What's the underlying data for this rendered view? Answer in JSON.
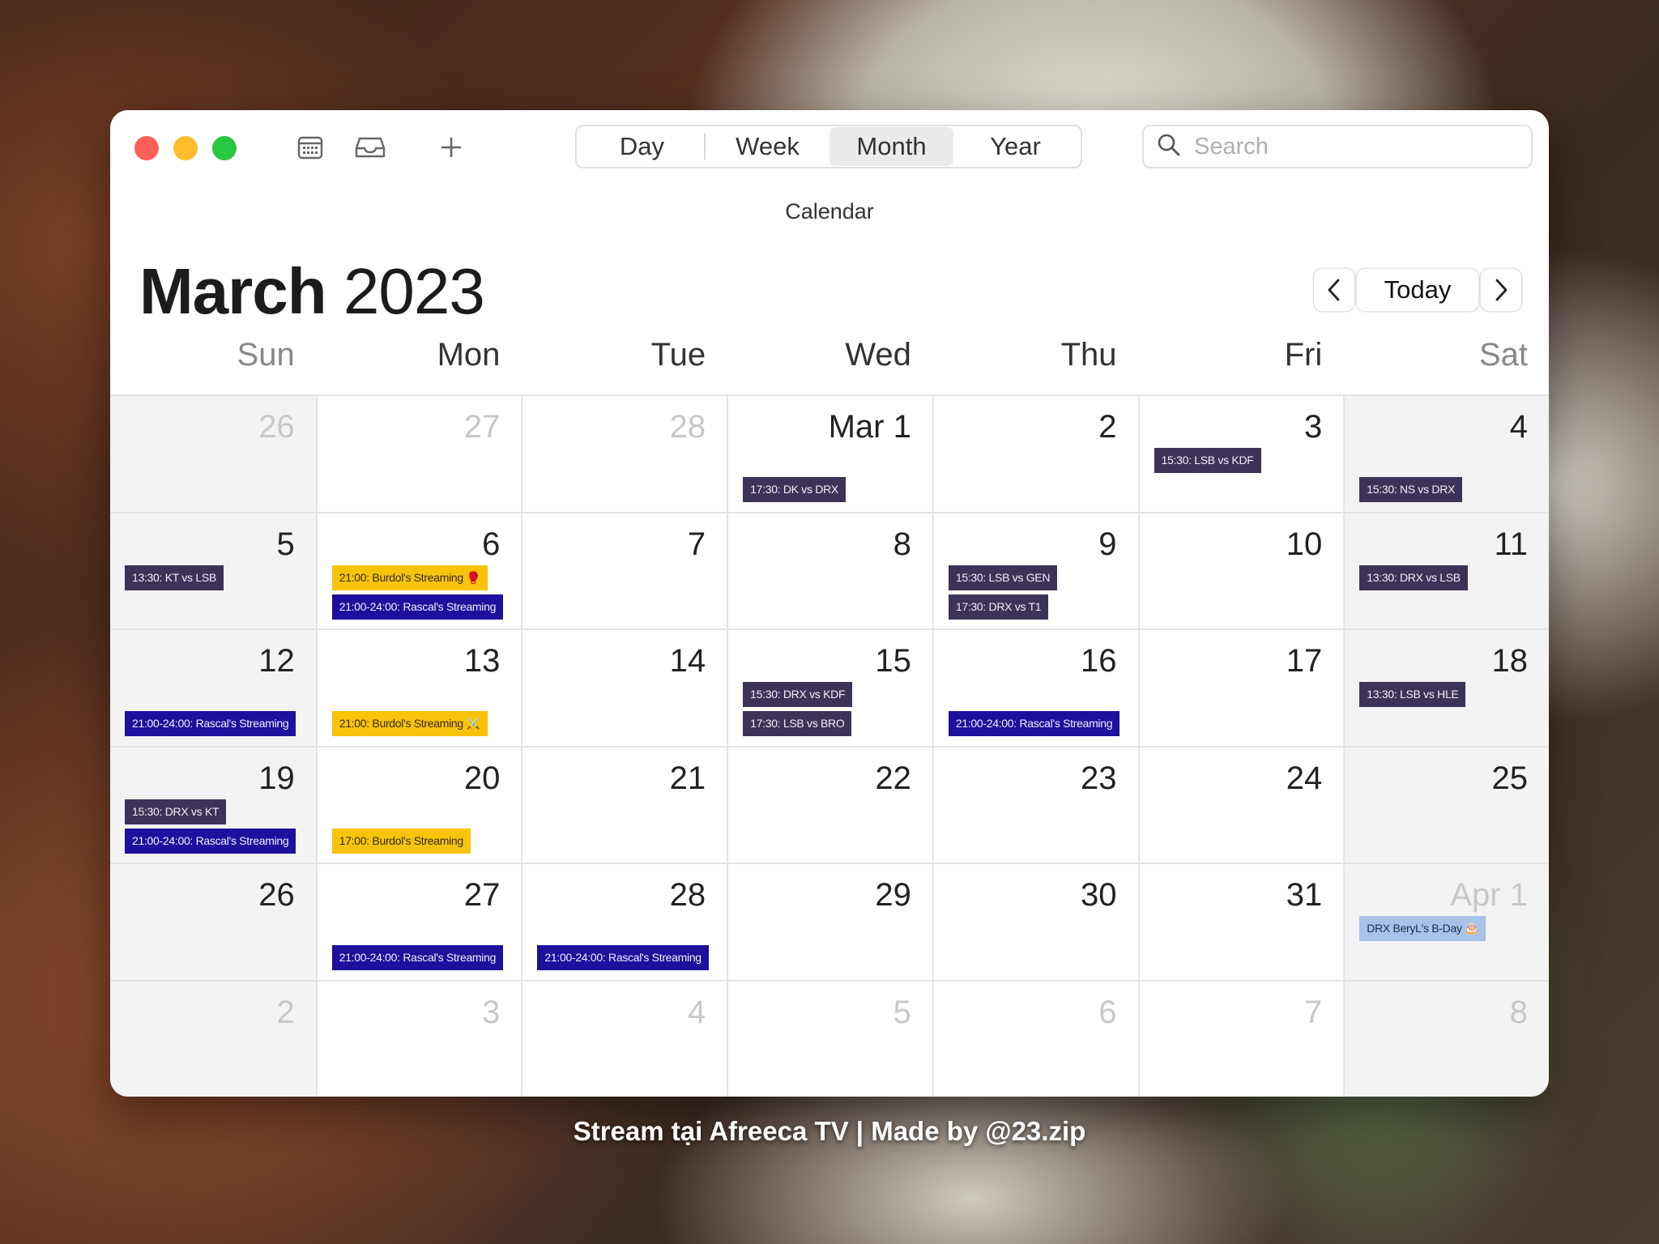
{
  "toolbar": {
    "views": [
      "Day",
      "Week",
      "Month",
      "Year"
    ],
    "active_view": "Month",
    "search_placeholder": "Search"
  },
  "header": {
    "calendar_label": "Calendar",
    "month": "March",
    "year": "2023",
    "today_label": "Today"
  },
  "weekdays": [
    "Sun",
    "Mon",
    "Tue",
    "Wed",
    "Thu",
    "Fri",
    "Sat"
  ],
  "weeks": [
    [
      {
        "label": "26",
        "dim": true,
        "events": []
      },
      {
        "label": "27",
        "dim": true,
        "events": []
      },
      {
        "label": "28",
        "dim": true,
        "events": []
      },
      {
        "label": "Mar 1",
        "dim": false,
        "events": [
          {
            "text": "17:30: DK vs DRX",
            "kind": "match",
            "slot": 2
          }
        ]
      },
      {
        "label": "2",
        "dim": false,
        "events": []
      },
      {
        "label": "3",
        "dim": false,
        "events": [
          {
            "text": "15:30: LSB vs KDF",
            "kind": "match",
            "slot": 1
          }
        ]
      },
      {
        "label": "4",
        "dim": false,
        "events": [
          {
            "text": "15:30: NS vs DRX",
            "kind": "match",
            "slot": 2
          }
        ]
      }
    ],
    [
      {
        "label": "5",
        "dim": false,
        "events": [
          {
            "text": "13:30: KT vs LSB",
            "kind": "match",
            "slot": 1
          }
        ]
      },
      {
        "label": "6",
        "dim": false,
        "events": [
          {
            "text": "21:00: Burdol's Streaming 🥊",
            "kind": "burdol",
            "slot": 1
          },
          {
            "text": "21:00-24:00: Rascal's Streaming",
            "kind": "stream",
            "slot": 2
          }
        ]
      },
      {
        "label": "7",
        "dim": false,
        "events": []
      },
      {
        "label": "8",
        "dim": false,
        "events": []
      },
      {
        "label": "9",
        "dim": false,
        "events": [
          {
            "text": "15:30: LSB vs GEN",
            "kind": "match",
            "slot": 1
          },
          {
            "text": "17:30: DRX vs T1",
            "kind": "match",
            "slot": 2
          }
        ]
      },
      {
        "label": "10",
        "dim": false,
        "events": []
      },
      {
        "label": "11",
        "dim": false,
        "events": [
          {
            "text": "13:30: DRX vs LSB",
            "kind": "match",
            "slot": 1
          }
        ]
      }
    ],
    [
      {
        "label": "12",
        "dim": false,
        "events": [
          {
            "text": "21:00-24:00: Rascal's Streaming",
            "kind": "stream",
            "slot": 2
          }
        ]
      },
      {
        "label": "13",
        "dim": false,
        "events": [
          {
            "text": "21:00: Burdol's Streaming ⚔️",
            "kind": "burdol",
            "slot": 2
          }
        ]
      },
      {
        "label": "14",
        "dim": false,
        "events": []
      },
      {
        "label": "15",
        "dim": false,
        "events": [
          {
            "text": "15:30: DRX vs KDF",
            "kind": "match",
            "slot": 1
          },
          {
            "text": "17:30: LSB vs BRO",
            "kind": "match",
            "slot": 2
          }
        ]
      },
      {
        "label": "16",
        "dim": false,
        "events": [
          {
            "text": "21:00-24:00: Rascal's Streaming",
            "kind": "stream",
            "slot": 2
          }
        ]
      },
      {
        "label": "17",
        "dim": false,
        "events": []
      },
      {
        "label": "18",
        "dim": false,
        "events": [
          {
            "text": "13:30: LSB vs HLE",
            "kind": "match",
            "slot": 1
          }
        ]
      }
    ],
    [
      {
        "label": "19",
        "dim": false,
        "events": [
          {
            "text": "15:30: DRX vs KT",
            "kind": "match",
            "slot": 1
          },
          {
            "text": "21:00-24:00: Rascal's Streaming",
            "kind": "stream",
            "slot": 2
          }
        ]
      },
      {
        "label": "20",
        "dim": false,
        "events": [
          {
            "text": "17:00: Burdol's Streaming",
            "kind": "burdol",
            "slot": 2
          }
        ]
      },
      {
        "label": "21",
        "dim": false,
        "events": []
      },
      {
        "label": "22",
        "dim": false,
        "events": []
      },
      {
        "label": "23",
        "dim": false,
        "events": []
      },
      {
        "label": "24",
        "dim": false,
        "events": []
      },
      {
        "label": "25",
        "dim": false,
        "events": []
      }
    ],
    [
      {
        "label": "26",
        "dim": false,
        "events": []
      },
      {
        "label": "27",
        "dim": false,
        "events": [
          {
            "text": "21:00-24:00: Rascal's Streaming",
            "kind": "stream",
            "slot": 2
          }
        ]
      },
      {
        "label": "28",
        "dim": false,
        "events": [
          {
            "text": "21:00-24:00: Rascal's Streaming",
            "kind": "stream",
            "slot": 2
          }
        ]
      },
      {
        "label": "29",
        "dim": false,
        "events": []
      },
      {
        "label": "30",
        "dim": false,
        "events": []
      },
      {
        "label": "31",
        "dim": false,
        "events": []
      },
      {
        "label": "Apr 1",
        "dim": true,
        "events": [
          {
            "text": "DRX BeryL's B-Day 🎂",
            "kind": "bday",
            "slot": 1
          }
        ]
      }
    ],
    [
      {
        "label": "2",
        "dim": true,
        "events": []
      },
      {
        "label": "3",
        "dim": true,
        "events": []
      },
      {
        "label": "4",
        "dim": true,
        "events": []
      },
      {
        "label": "5",
        "dim": true,
        "events": []
      },
      {
        "label": "6",
        "dim": true,
        "events": []
      },
      {
        "label": "7",
        "dim": true,
        "events": []
      },
      {
        "label": "8",
        "dim": true,
        "events": []
      }
    ]
  ],
  "colors": {
    "match": "#3d3358",
    "stream": "#1e0f9c",
    "burdol": "#f7c40b",
    "bday": "#a8c2e8"
  },
  "footer": "Stream tại Afreeca TV | Made by @23.zip"
}
